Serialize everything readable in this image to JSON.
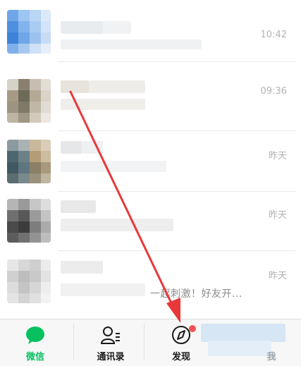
{
  "chats": [
    {
      "time": "10:42",
      "preview": ""
    },
    {
      "time": "09:36",
      "preview": ""
    },
    {
      "time": "昨天",
      "preview": ""
    },
    {
      "time": "昨天",
      "preview": ""
    },
    {
      "time": "昨天",
      "preview": "一起刺激！好友开..."
    }
  ],
  "tabbar": {
    "tabs": [
      {
        "label": "微信",
        "icon": "chat-bubble-icon",
        "active": true
      },
      {
        "label": "通讯录",
        "icon": "contacts-icon",
        "active": false
      },
      {
        "label": "发现",
        "icon": "compass-icon",
        "active": false,
        "badge": true
      },
      {
        "label": "我",
        "icon": "me-icon",
        "active": false
      }
    ]
  },
  "colors": {
    "accent": "#07c160",
    "annotation_arrow": "#e8393a",
    "badge": "#f05454"
  }
}
